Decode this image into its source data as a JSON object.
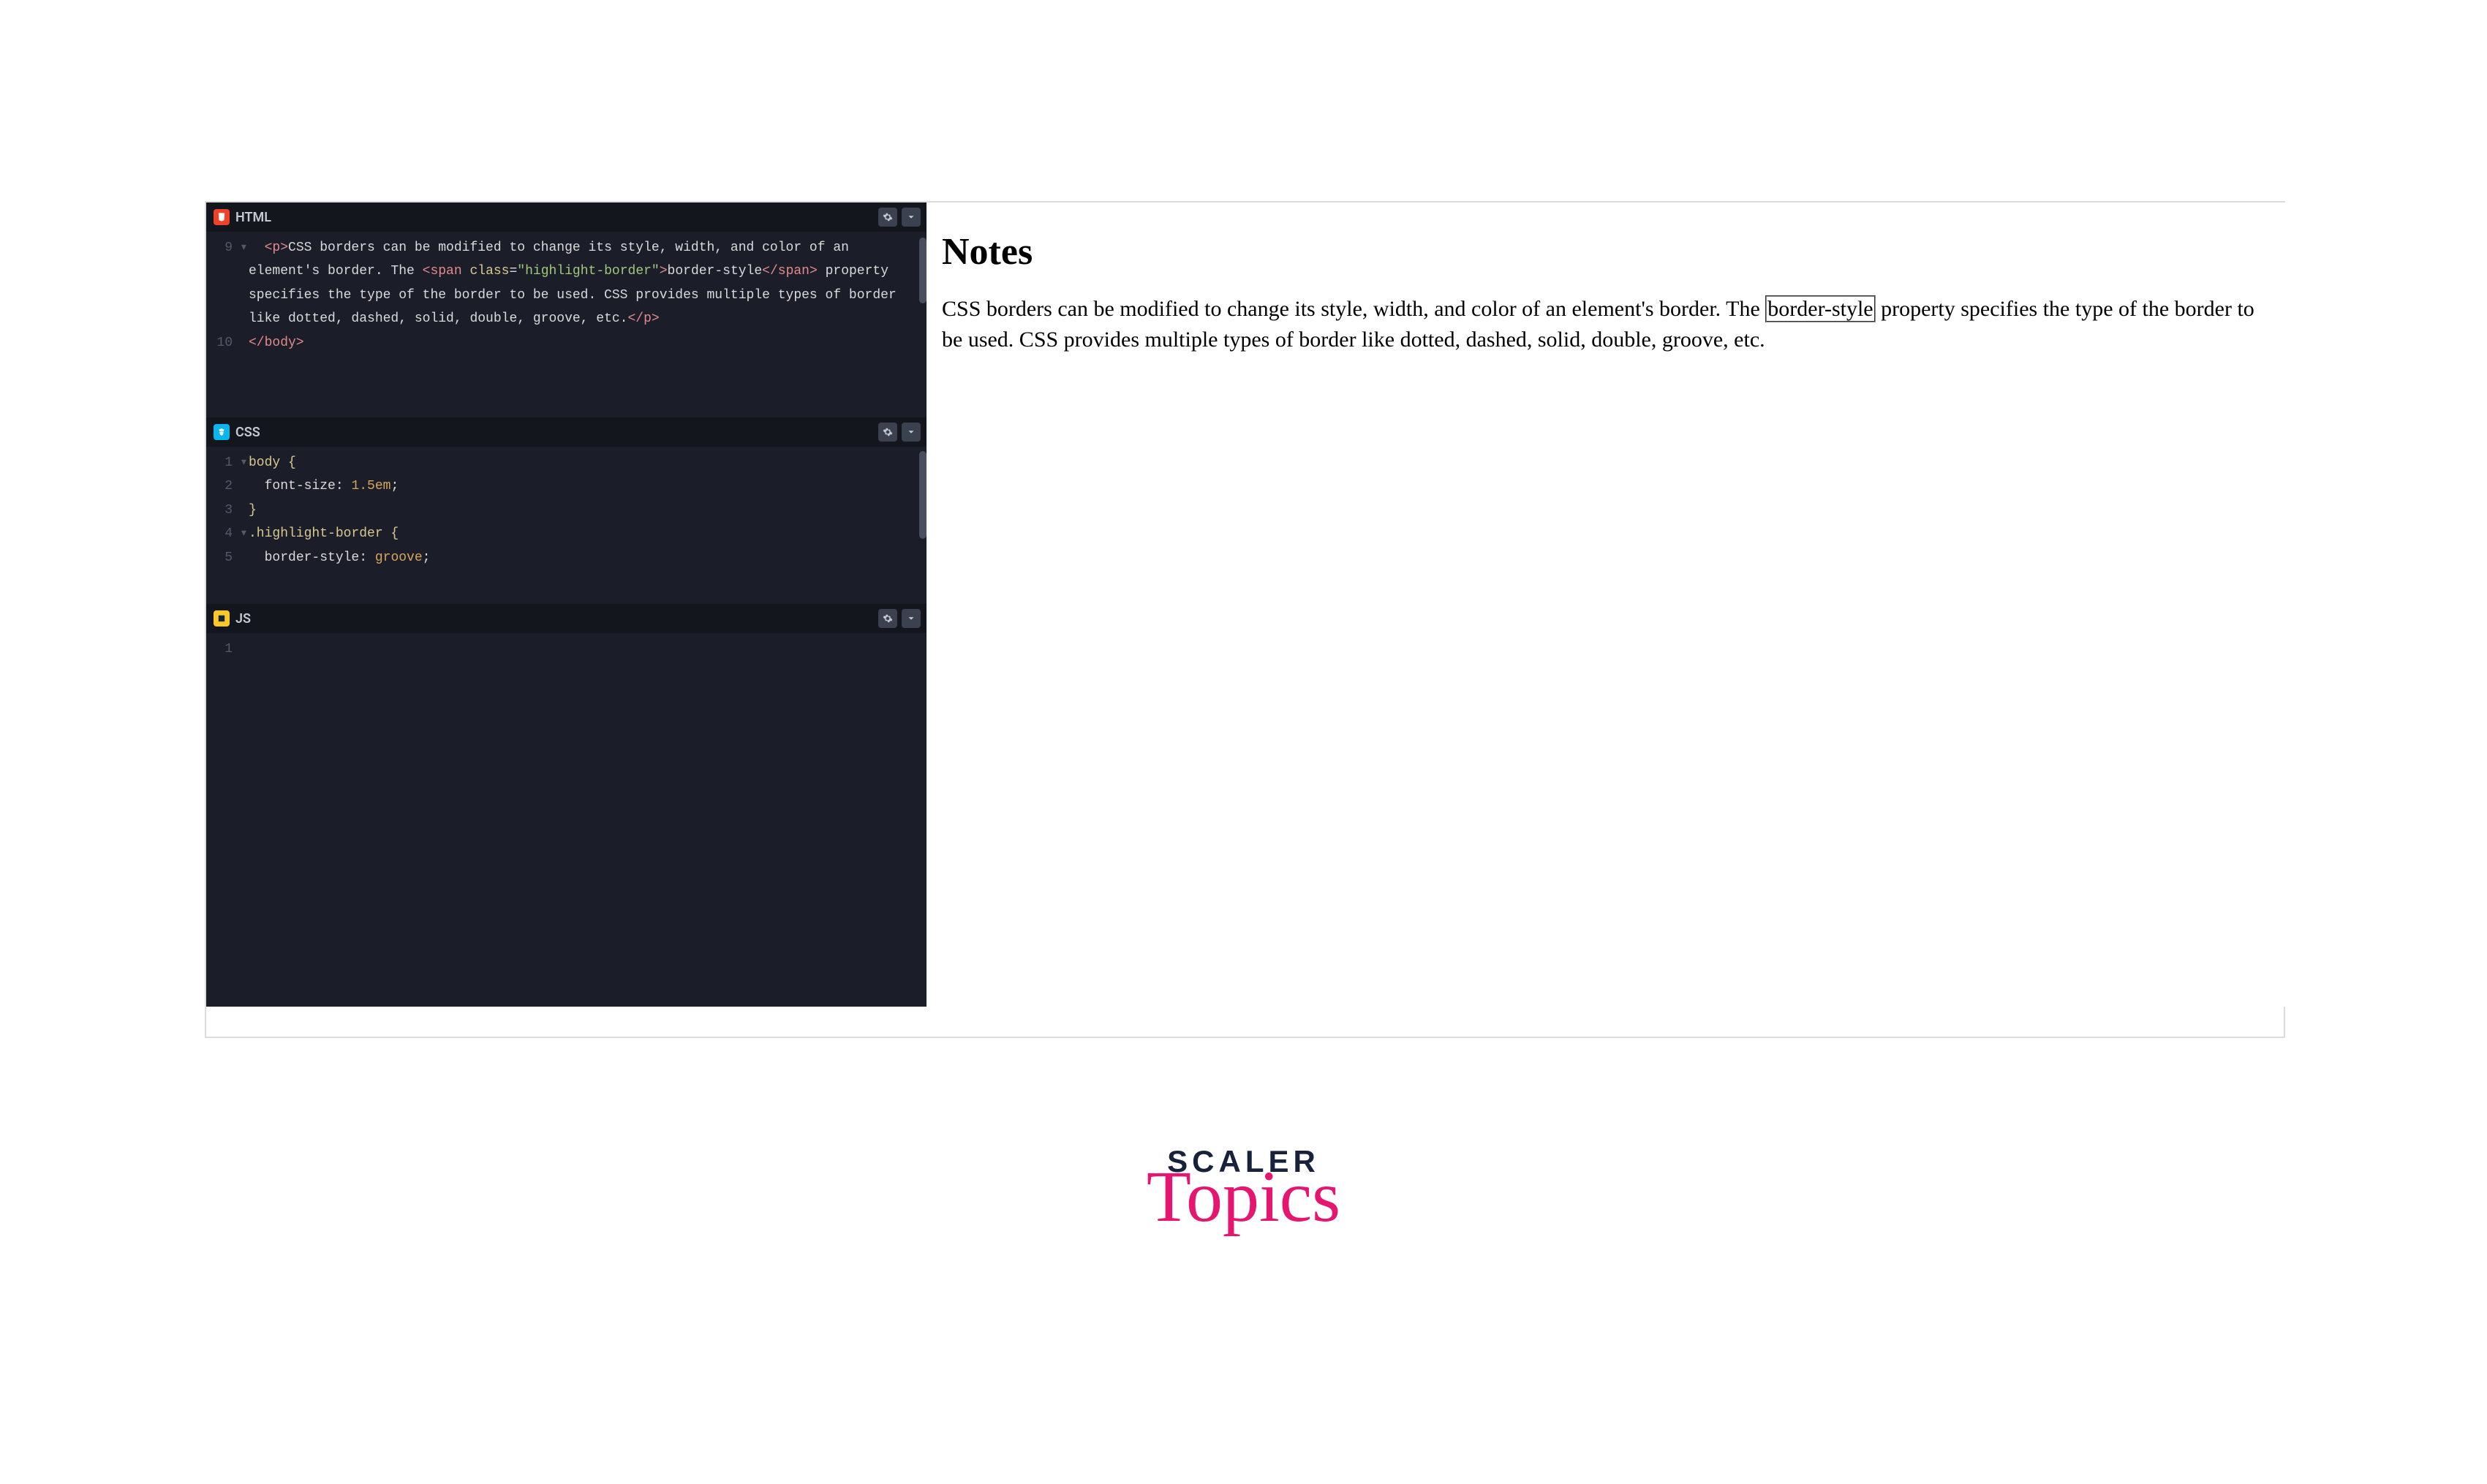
{
  "panels": {
    "html": {
      "title": "HTML"
    },
    "css": {
      "title": "CSS"
    },
    "js": {
      "title": "JS"
    }
  },
  "html_code": {
    "l9a": "<p>",
    "l9b": "CSS borders can be modified to change its style, width, and color of an element's border. The ",
    "l9c": "<span",
    "l9d": "class",
    "l9e": "=",
    "l9f": "\"highlight-border\"",
    "l9g": ">",
    "l9h": "border-style",
    "l9i": "</span>",
    "l9j": " property specifies the type of the border to be used. CSS provides multiple types of border like dotted, dashed, solid, double, groove, etc.",
    "l9k": "</p>",
    "l10": "</body>",
    "ln9": "9",
    "ln10": "10"
  },
  "css_code": {
    "ln1": "1",
    "ln2": "2",
    "ln3": "3",
    "ln4": "4",
    "ln5": "5",
    "l1": "body {",
    "l2p": "font-size",
    "l2c": ": ",
    "l2v": "1.5em",
    "l2s": ";",
    "l3": "}",
    "l4": ".highlight-border {",
    "l5p": "border-style",
    "l5c": ": ",
    "l5v": "groove",
    "l5s": ";"
  },
  "js_code": {
    "ln1": "1"
  },
  "preview": {
    "heading": "Notes",
    "para_a": "CSS borders can be modified to change its style, width, and color of an element's border. The ",
    "para_hl": "border-style",
    "para_b": " property specifies the type of the border to be used. CSS provides multiple types of border like dotted, dashed, solid, double, groove, etc."
  },
  "brand": {
    "top": "SCALER",
    "bottom": "Topics"
  }
}
